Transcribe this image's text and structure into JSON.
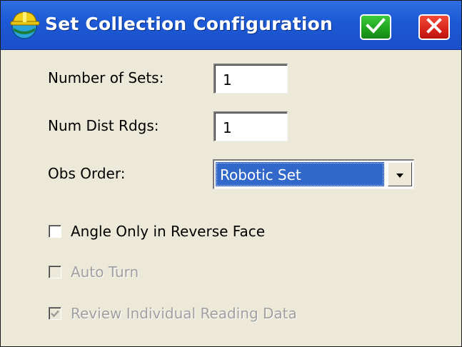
{
  "window": {
    "title": "Set Collection Configuration",
    "ok_icon": "checkmark-icon",
    "close_icon": "close-x-icon",
    "app_icon": "hardhat-globe-icon"
  },
  "fields": {
    "number_of_sets": {
      "label": "Number of Sets:",
      "value": "1"
    },
    "num_dist_rdgs": {
      "label": "Num Dist Rdgs:",
      "value": "1"
    },
    "obs_order": {
      "label": "Obs Order:",
      "value": "Robotic Set"
    }
  },
  "checkboxes": {
    "angle_only_reverse_face": {
      "label": "Angle Only in Reverse Face",
      "checked": false,
      "enabled": true
    },
    "auto_turn": {
      "label": "Auto Turn",
      "checked": false,
      "enabled": false
    },
    "review_individual_reading_data": {
      "label": "Review Individual Reading Data",
      "checked": true,
      "enabled": false
    }
  },
  "colors": {
    "titlebar": "#1d5ad6",
    "ok_button": "#1ea21e",
    "close_button": "#d9251a",
    "selection": "#3168c9",
    "dialog_background": "#ece9d8"
  }
}
